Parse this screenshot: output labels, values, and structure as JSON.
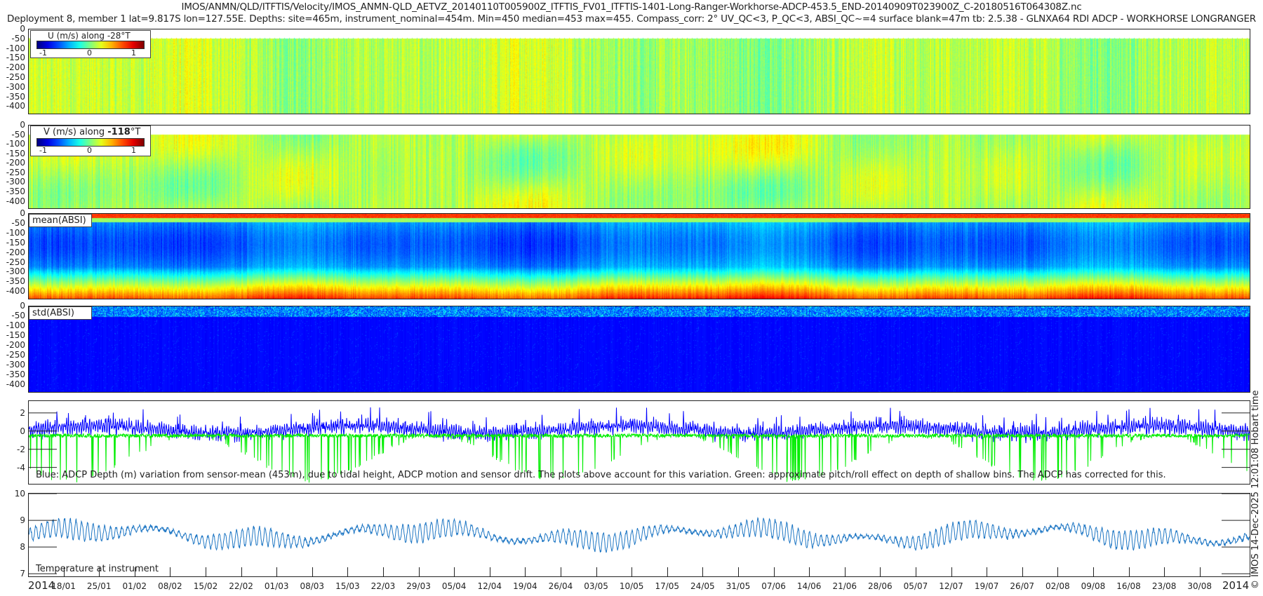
{
  "title": {
    "line1": "IMOS/ANMN/QLD/ITFTIS/Velocity/IMOS_ANMN-QLD_AETVZ_20140110T005900Z_ITFTIS_FV01_ITFTIS-1401-Long-Ranger-Workhorse-ADCP-453.5_END-20140909T023900Z_C-20180516T064308Z.nc",
    "line2": "Deployment 8, member 1 lat=9.817S lon=127.55E. Depths: site=465m, instrument_nominal=454m. Min=450 median=453 max=455. Compass_corr: 2° UV_QC<3, P_QC<3, ABSI_QC~=4 surface blank=47m tb: 2.5.38 - GLNXA64 RDI ADCP - WORKHORSE LONGRANGER"
  },
  "credit": "© IMOS 14-Dec-2025 12:01:08 Hobart time",
  "colors": {
    "blue_line": "#0000ff",
    "green_line": "#00ee00",
    "temp_line": "#1f77c4",
    "colormap": "jet"
  },
  "x_axis": {
    "year_left": "2014",
    "year_right": "2014",
    "range": [
      "2014-01-11",
      "2014-09-09"
    ],
    "ticks": [
      "18/01",
      "25/01",
      "01/02",
      "08/02",
      "15/02",
      "22/02",
      "01/03",
      "08/03",
      "15/03",
      "22/03",
      "29/03",
      "05/04",
      "12/04",
      "19/04",
      "26/04",
      "03/05",
      "10/05",
      "17/05",
      "24/05",
      "31/05",
      "07/06",
      "14/06",
      "21/06",
      "28/06",
      "05/07",
      "12/07",
      "19/07",
      "26/07",
      "02/08",
      "09/08",
      "16/08",
      "23/08",
      "30/08"
    ]
  },
  "chart_data": [
    {
      "type": "heatmap",
      "legend": "U (m/s) along -28°T",
      "colorbar_ticks": [
        "-1",
        "0",
        "1"
      ],
      "clim": [
        -1.2,
        1.2
      ],
      "ylim": [
        0,
        435
      ],
      "yticks": [
        "0",
        "-50",
        "-100",
        "-150",
        "-200",
        "-250",
        "-300",
        "-350",
        "-400"
      ],
      "surface_blank_m": 47
    },
    {
      "type": "heatmap",
      "legend_prefix": "V (m/s) along ",
      "legend_bold": "-118",
      "legend_suffix": "°T",
      "colorbar_ticks": [
        "-1",
        "0",
        "1"
      ],
      "clim": [
        -1.2,
        1.2
      ],
      "ylim": [
        0,
        435
      ],
      "yticks": [
        "0",
        "-50",
        "-100",
        "-150",
        "-200",
        "-250",
        "-300",
        "-350",
        "-400"
      ]
    },
    {
      "type": "heatmap",
      "legend": "mean(ABSI)",
      "ylim": [
        0,
        435
      ],
      "yticks": [
        "0",
        "-50",
        "-100",
        "-150",
        "-200",
        "-250",
        "-300",
        "-350",
        "-400"
      ]
    },
    {
      "type": "heatmap",
      "legend": "std(ABSI)",
      "ylim": [
        0,
        435
      ],
      "yticks": [
        "0",
        "-50",
        "-100",
        "-150",
        "-200",
        "-250",
        "-300",
        "-350",
        "-400"
      ]
    },
    {
      "type": "line",
      "ylim": [
        -5.8,
        3.3
      ],
      "yticks": [
        "2",
        "0",
        "-2",
        "-4"
      ],
      "annotation": "Blue: ADCP Depth (m) variation from sensor-mean (453m), due to tidal height, ADCP motion and sensor drift. The plots above account for this variation. Green: approximate pitch/roll effect on depth of shallow bins. The ADCP has corrected for this.",
      "series": [
        {
          "color": "#0000ff",
          "range": [
            -1.5,
            2.7
          ]
        },
        {
          "color": "#00ee00",
          "range": [
            -5.8,
            0.3
          ]
        }
      ]
    },
    {
      "type": "line",
      "ylim": [
        6.9,
        10
      ],
      "yticks": [
        "10",
        "9",
        "8",
        "7"
      ],
      "annotation": "Temperature at instrument",
      "series": [
        {
          "color": "#1f77c4",
          "range": [
            7.1,
            9.9
          ]
        }
      ]
    }
  ]
}
